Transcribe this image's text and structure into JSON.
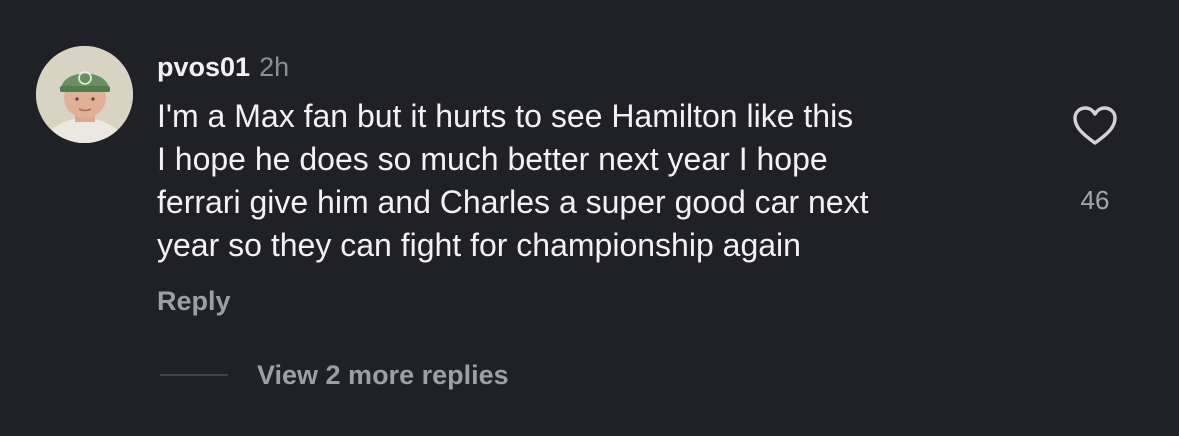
{
  "comment": {
    "username": "pvos01",
    "time": "2h",
    "lines": [
      "I'm a Max fan but it hurts to see Hamilton like this",
      "I hope he does so much better next year I hope",
      "ferrari give him and Charles a super good car next",
      "year so they can fight for championship again"
    ],
    "like_count": "46",
    "reply_label": "Reply",
    "more_replies_label": "View 2 more replies"
  },
  "icons": {
    "like": "heart-icon"
  },
  "colors": {
    "background": "#202027",
    "text": "#f2f2f5",
    "secondary": "#9e9ea6",
    "muted": "#8e8e98"
  }
}
